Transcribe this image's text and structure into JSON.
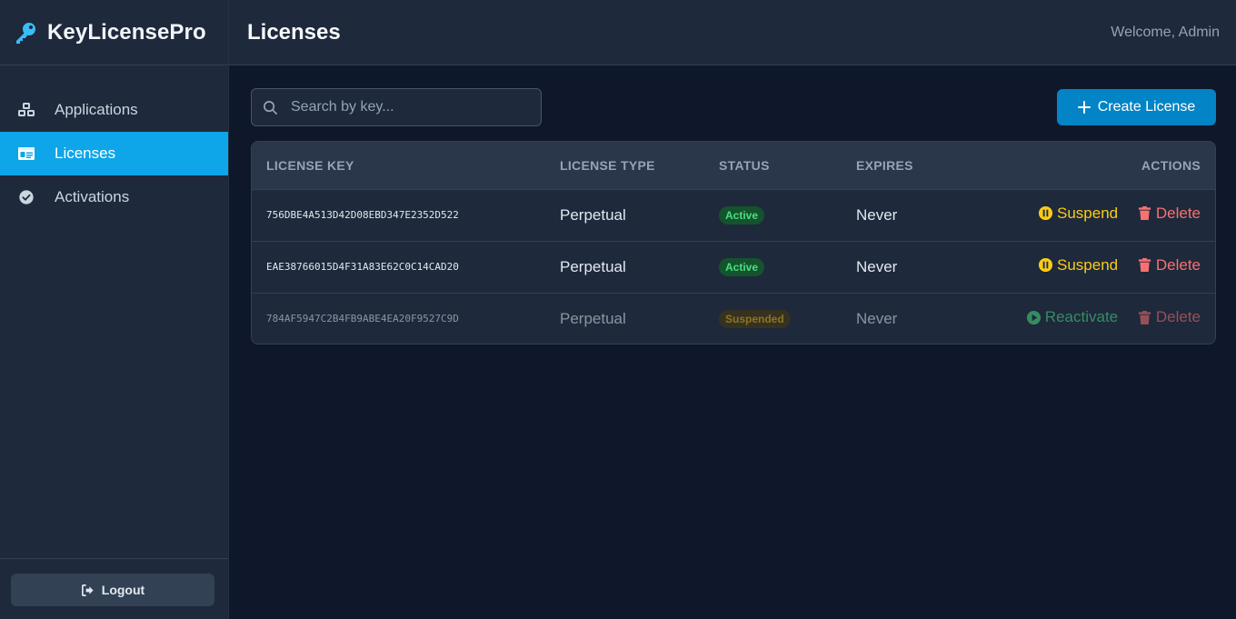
{
  "brand": {
    "name": "KeyLicensePro",
    "accent": "#38bdf8"
  },
  "sidebar": {
    "items": [
      {
        "label": "Applications",
        "icon": "cubes-icon",
        "active": false
      },
      {
        "label": "Licenses",
        "icon": "id-card-icon",
        "active": true
      },
      {
        "label": "Activations",
        "icon": "check-circle-icon",
        "active": false
      }
    ],
    "logout_label": "Logout"
  },
  "header": {
    "title": "Licenses",
    "welcome": "Welcome, Admin"
  },
  "toolbar": {
    "search_placeholder": "Search by key...",
    "create_label": "Create License"
  },
  "table": {
    "columns": [
      "LICENSE KEY",
      "LICENSE TYPE",
      "STATUS",
      "EXPIRES",
      "ACTIONS"
    ],
    "rows": [
      {
        "key": "756DBE4A513D42D08EBD347E2352D522",
        "type": "Perpetual",
        "status": "Active",
        "expires": "Never",
        "primary_action": "Suspend",
        "delete_label": "Delete"
      },
      {
        "key": "EAE38766015D4F31A83E62C0C14CAD20",
        "type": "Perpetual",
        "status": "Active",
        "expires": "Never",
        "primary_action": "Suspend",
        "delete_label": "Delete"
      },
      {
        "key": "784AF5947C2B4FB9ABE4EA20F9527C9D",
        "type": "Perpetual",
        "status": "Suspended",
        "expires": "Never",
        "primary_action": "Reactivate",
        "delete_label": "Delete"
      }
    ]
  },
  "colors": {
    "active_nav": "#0ea5e9",
    "create_button": "#0284c7",
    "suspend": "#facc15",
    "delete": "#f87171",
    "reactivate": "#4ade80"
  }
}
